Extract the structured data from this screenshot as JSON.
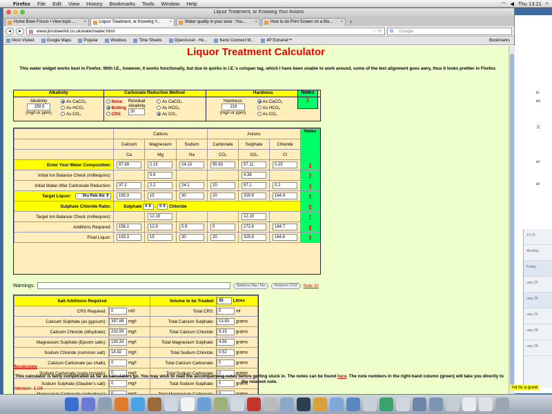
{
  "menubar": {
    "app": "Firefox",
    "items": [
      "File",
      "Edit",
      "View",
      "History",
      "Bookmarks",
      "Tools",
      "Window",
      "Help"
    ],
    "clock": "Thu 13:21"
  },
  "window": {
    "title": "Liquor Treatment, or Knowing Your Anions",
    "tabs": [
      {
        "label": "Home Brew Forum • View topic ..."
      },
      {
        "label": "Liquor Treatment, or Knowing Y..."
      },
      {
        "label": "Water quality in your area : You..."
      },
      {
        "label": "How to do Print Screen on a Ma..."
      }
    ],
    "url": "www.jimsbeerkit.co.uk/water/water.html",
    "search_placeholder": "Google",
    "bookmarks": [
      "Most Visited",
      "Google Maps",
      "Popular",
      "Woobius",
      "Time Sheets",
      "OpenAsset - Ho...",
      "Kerio Connect W...",
      "4P Extranet™"
    ],
    "bookmarks_right": "Bookmarks"
  },
  "page": {
    "title": "Liquor Treatment Calculator",
    "intro": "This water widget works best in Firefox. With I.E., however, it works functionally, but due to quirks in I.E.'s colspan tag, which I have been unable to work around, some of the text alignment goes awry, thus it looks prettier in Firefox.",
    "alkalinity": {
      "header": "Alkalinity",
      "label": "Alkalinity",
      "value": "159.5",
      "unit": "(mg/l or ppm)",
      "options": [
        "As CaCO₃",
        "As HCO₃",
        "As CO₃"
      ]
    },
    "carbonate": {
      "header": "Carbonate Reduction Method",
      "methods": [
        "None",
        "Boiling",
        "CRS"
      ],
      "residual_label": "Residual Alkalinity",
      "residual_value": "20",
      "options": [
        "As CaCO₃",
        "As HCO₃",
        "As CO₃"
      ]
    },
    "hardness": {
      "header": "Hardness",
      "label": "Hardness",
      "value": "219",
      "unit": "(mg/l or ppm)",
      "options": [
        "As CaCO₃",
        "As HCO₃",
        "As CO₃"
      ]
    },
    "notes_header": "Notes",
    "notes_link_1": "1",
    "grid": {
      "cations_header": "Cations",
      "anions_header": "Anions",
      "notes_header": "Notes",
      "ion_names": [
        "Calcium",
        "Magnesium",
        "Sodium",
        "Carbonate",
        "Sulphate",
        "Chloride"
      ],
      "ion_symbols": [
        "Ca",
        "Mg",
        "Na",
        "CO₃",
        "SO₄",
        "Cl"
      ],
      "rows": [
        {
          "label": "Enter Your Water Composition:",
          "cells": [
            "87.69",
            "2.15",
            "24.13",
            "95.63",
            "57.11",
            "0.25"
          ],
          "note": "2"
        },
        {
          "label": "Initial Ion Balance Check (milliequivs):",
          "cells": [
            "",
            "5.6",
            "",
            "",
            "4.38",
            ""
          ],
          "note": "3"
        },
        {
          "label": "Initial Water After Carbonate Reduction:",
          "cells": [
            "37.2",
            "2.2",
            "24.1",
            "20",
            "57.1",
            "0.2"
          ],
          "note": "4"
        },
        {
          "label": "Target Liquor:",
          "cells": [
            "193.3",
            "15",
            "30",
            "20",
            "329.9",
            "164.9"
          ],
          "note": "5"
        },
        {
          "label": "Sulphate Chloride Ratio:",
          "cells": [],
          "note": "6"
        },
        {
          "label": "Target Ion Balance Check (milliequivs):",
          "cells": [
            "",
            "12.19",
            "",
            "",
            "12.19",
            ""
          ],
          "note": "7"
        },
        {
          "label": "Additions Required:",
          "cells": [
            "156.1",
            "12.9",
            "5.9",
            "0",
            "272.8",
            "164.7"
          ],
          "note": "8"
        },
        {
          "label": "Final Liquor:",
          "cells": [
            "193.3",
            "15",
            "30",
            "20",
            "329.9",
            "164.9"
          ],
          "note": "9"
        }
      ],
      "target_select": "Dry Pale Ale",
      "ratio": {
        "sulphate": "Sulphate",
        "left": "0",
        "right": "0",
        "chloride": "Chloride",
        "sep": ":"
      }
    },
    "warnings_label": "Warnings:",
    "balance_mg_na": "Balance Mg / Na",
    "balance_co3": "Balance CO3",
    "note_10": "Note 10",
    "salts": {
      "header": "Salt Additions Required",
      "volume_label": "Volume to be Treated:",
      "volume_value": "35",
      "volume_unit": "Litres",
      "rows": [
        {
          "name": "CRS Required:",
          "value": "0",
          "unit": "ml/l",
          "total_label": "Total CRS:",
          "total": "0",
          "tunit": "ml"
        },
        {
          "name": "Calcium Sulphate (as gypsum):",
          "value": "397.89",
          "unit": "mg/l",
          "total_label": "Total Calcium Sulphate:",
          "total": "13.93",
          "tunit": "grams"
        },
        {
          "name": "Calcium Chloride (dihydrate):",
          "value": "232.93",
          "unit": "mg/l",
          "total_label": "Total Calcium Chloride:",
          "total": "8.15",
          "tunit": "grams"
        },
        {
          "name": "Magnesium Sulphate (Epsom salts):",
          "value": "130.33",
          "unit": "mg/l",
          "total_label": "Total Magnesium Sulphate:",
          "total": "4.56",
          "tunit": "grams"
        },
        {
          "name": "Sodium Chloride (common salt):",
          "value": "14.92",
          "unit": "mg/l",
          "total_label": "Total Sodium Chloride:",
          "total": "0.52",
          "tunit": "grams"
        },
        {
          "name": "Calcium Carbonate (as chalk):",
          "value": "0",
          "unit": "mg/l",
          "total_label": "Total Calcium Carbonate:",
          "total": "0",
          "tunit": "grams"
        },
        {
          "name": "Sodium Carbonate (soda crystals):",
          "value": "0",
          "unit": "mg/l",
          "total_label": "Total Sodium Carbonate:",
          "total": "0",
          "tunit": "grams"
        },
        {
          "name": "Sodium Sulphate (Glauber's salt):",
          "value": "0",
          "unit": "mg/l",
          "total_label": "Total Sodium Sulphate:",
          "total": "0",
          "tunit": "grams"
        },
        {
          "name": "Magnesium Carbonate (anhydrous):",
          "value": "0",
          "unit": "mg/l",
          "total_label": "Total Magnesium Carbonate:",
          "total": "0",
          "tunit": "grams"
        }
      ]
    },
    "recalculate": "Recalculate",
    "footer_a": "This calculator is fairly complicated as far as calculators go. You may wish to read the accompanying notes before getting stuck in. The notes can be found ",
    "footer_link": "here",
    "footer_b": ". The note numbers in the right-hand column (green) will take you directly to the relavent note.",
    "version": "Version:  1.04"
  },
  "background": {
    "corner_text": "nd its a good",
    "mail_dates": [
      "13:19",
      "Monday",
      "Friday",
      "uary 29",
      "uary 29",
      "uary 29",
      "uary 28",
      "uary 28"
    ]
  },
  "colors": {
    "title_red": "#ee0000",
    "yellow": "#ffff00",
    "green": "#00ff66",
    "panel": "#ffeebb",
    "page_bg": "#eeffcc"
  }
}
